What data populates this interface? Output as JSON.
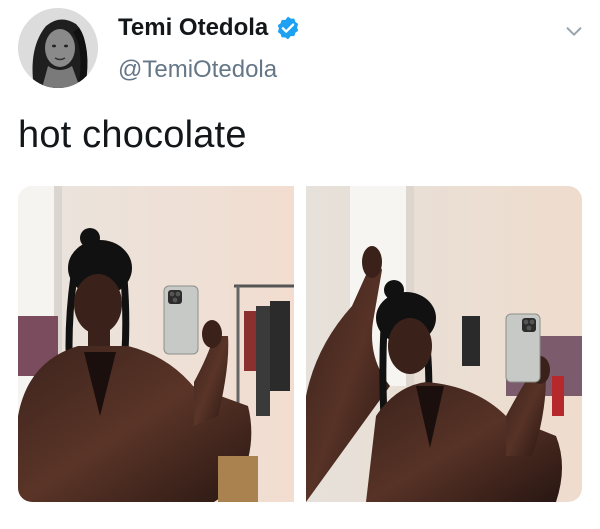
{
  "tweet": {
    "author": {
      "display_name": "Temi Otedola",
      "handle": "@TemiOtedola",
      "verified": true,
      "verified_icon": "verified-badge-icon",
      "avatar_icon": "profile-avatar"
    },
    "text": "hot chocolate",
    "menu_icon": "chevron-down-icon",
    "media": [
      {
        "name": "photo-1",
        "description_icon": "mirror-selfie-photo"
      },
      {
        "name": "photo-2",
        "description_icon": "mirror-selfie-photo"
      }
    ]
  },
  "colors": {
    "primary_text": "#14171a",
    "secondary_text": "#657786",
    "verified_blue": "#1da1f2",
    "background": "#ffffff"
  }
}
